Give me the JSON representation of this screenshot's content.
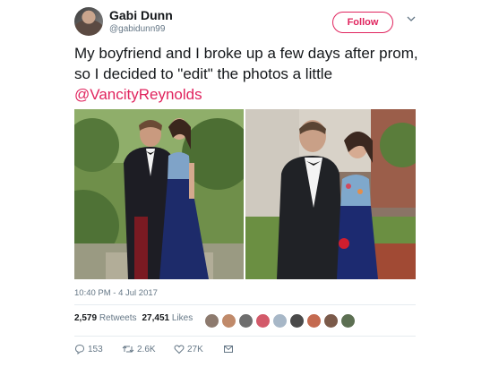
{
  "user": {
    "name": "Gabi Dunn",
    "handle": "@gabidunn99"
  },
  "follow_label": "Follow",
  "tweet": {
    "text": "My boyfriend and I broke up a few days after prom, so I decided to \"edit\" the photos a little",
    "mention": "@VancityReynolds",
    "timestamp": "10:40 PM - 4 Jul 2017"
  },
  "stats": {
    "retweets_count": "2,579",
    "retweets_label": "Retweets",
    "likes_count": "27,451",
    "likes_label": "Likes"
  },
  "actions": {
    "reply_count": "153",
    "retweet_count": "2.6K",
    "like_count": "27K"
  },
  "colors": {
    "accent": "#e0245e",
    "muted": "#657786"
  },
  "icons": [
    "chevron-down-icon",
    "reply-icon",
    "retweet-icon",
    "heart-icon",
    "message-icon"
  ]
}
